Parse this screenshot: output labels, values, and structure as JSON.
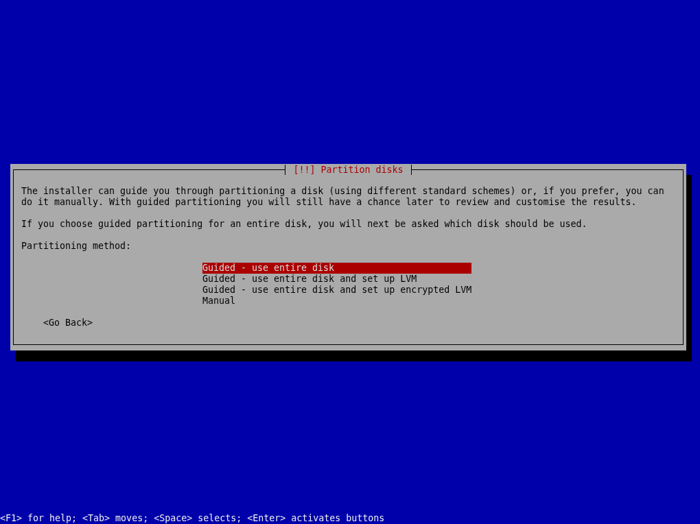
{
  "dialog": {
    "title": "[!!] Partition disks",
    "paragraphs": [
      "The installer can guide you through partitioning a disk (using different standard schemes) or, if you prefer, you can do it manually. With guided partitioning you will still have a chance later to review and customise the results.",
      "If you choose guided partitioning for an entire disk, you will next be asked which disk should be used."
    ],
    "prompt": "Partitioning method:",
    "options": [
      {
        "label": "Guided - use entire disk",
        "selected": true
      },
      {
        "label": "Guided - use entire disk and set up LVM",
        "selected": false
      },
      {
        "label": "Guided - use entire disk and set up encrypted LVM",
        "selected": false
      },
      {
        "label": "Manual",
        "selected": false
      }
    ],
    "buttons": [
      "<Go Back>"
    ]
  },
  "status_bar": "<F1> for help; <Tab> moves; <Space> selects; <Enter> activates buttons"
}
